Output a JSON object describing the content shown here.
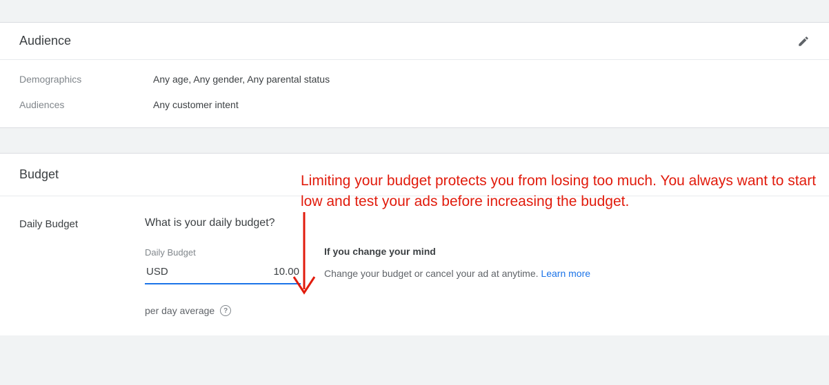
{
  "audience": {
    "title": "Audience",
    "rows": {
      "demographics": {
        "label": "Demographics",
        "value": "Any age, Any gender, Any parental status"
      },
      "audiences": {
        "label": "Audiences",
        "value": "Any customer intent"
      }
    }
  },
  "budget": {
    "title": "Budget",
    "daily": {
      "label": "Daily Budget",
      "heading": "What is your daily budget?",
      "input_label": "Daily Budget",
      "currency": "USD",
      "amount": "10.00",
      "per_day_text": "per day average"
    },
    "right": {
      "heading": "If you change your mind",
      "text": "Change your budget or cancel your ad at anytime. ",
      "link": "Learn more"
    }
  },
  "annotation": {
    "text": "Limiting your budget protects you from losing too much. You always want to start low and test your ads before increasing the budget."
  }
}
